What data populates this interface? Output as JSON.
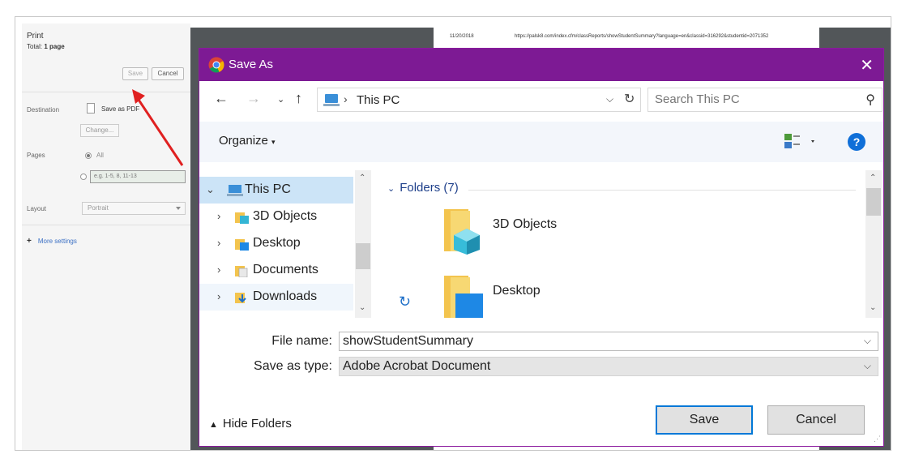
{
  "print_panel": {
    "title": "Print",
    "total_label": "Total:",
    "total_value": "1 page",
    "save_label": "Save",
    "cancel_label": "Cancel",
    "destination_label": "Destination",
    "destination_value": "Save as PDF",
    "change_label": "Change...",
    "pages_label": "Pages",
    "pages_all": "All",
    "pages_range_placeholder": "e.g. 1-5, 8, 11-13",
    "layout_label": "Layout",
    "layout_value": "Portrait",
    "more_settings": "More settings"
  },
  "preview": {
    "date": "11/20/2018",
    "url": "https://palsk8.com/index.cfm/classReports/showStudentSummary?language=en&classid=316292&studentid=2071352"
  },
  "dialog": {
    "title": "Save As",
    "address_location": "This PC",
    "search_placeholder": "Search This PC",
    "organize_label": "Organize",
    "help_label": "?",
    "nav_items": [
      {
        "label": "This PC",
        "icon": "pc-icon",
        "selected": true
      },
      {
        "label": "3D Objects",
        "icon": "3d-objects-folder-icon",
        "selected": false
      },
      {
        "label": "Desktop",
        "icon": "desktop-folder-icon",
        "selected": false
      },
      {
        "label": "Documents",
        "icon": "documents-folder-icon",
        "selected": false
      },
      {
        "label": "Downloads",
        "icon": "downloads-folder-icon",
        "selected": false
      }
    ],
    "folders_group": "Folders (7)",
    "folders": [
      {
        "label": "3D Objects",
        "icon": "3d-objects-folder-icon"
      },
      {
        "label": "Desktop",
        "icon": "desktop-folder-icon"
      }
    ],
    "file_name_label": "File name:",
    "file_name_value": "showStudentSummary",
    "save_type_label": "Save as type:",
    "save_type_value": "Adobe Acrobat Document",
    "hide_folders_label": "Hide Folders",
    "save_button": "Save",
    "cancel_button": "Cancel"
  },
  "colors": {
    "titlebar": "#7d1a94",
    "selection": "#cce4f7",
    "accent": "#0078d7",
    "annotation_arrow": "#e02020"
  }
}
